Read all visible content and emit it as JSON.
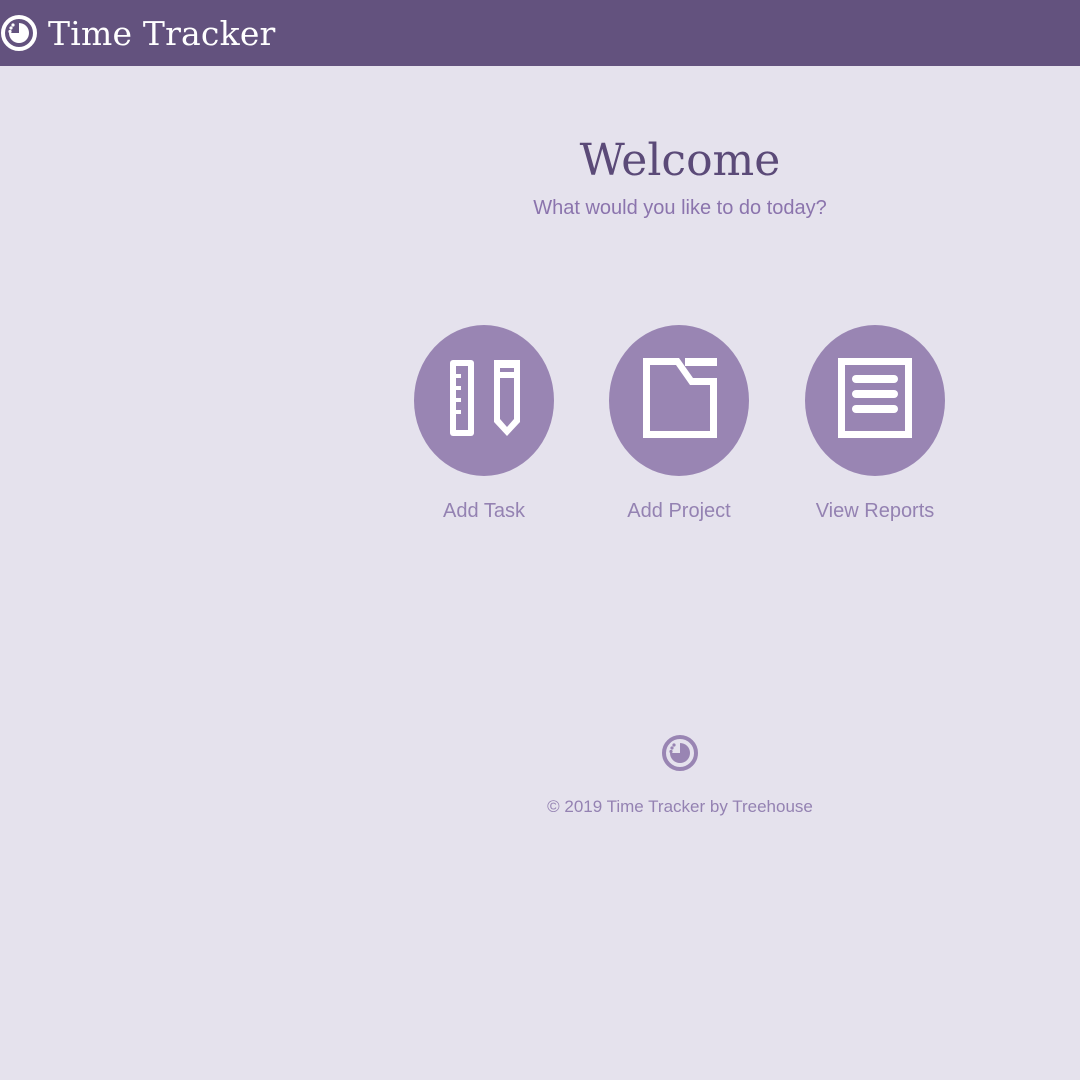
{
  "header": {
    "title": "Time Tracker",
    "logo_icon": "clock-icon"
  },
  "main": {
    "title": "Welcome",
    "subtitle": "What would you like to do today?",
    "actions": [
      {
        "label": "Add Task",
        "icon": "ruler-pencil-icon"
      },
      {
        "label": "Add Project",
        "icon": "folder-icon"
      },
      {
        "label": "View Reports",
        "icon": "document-icon"
      }
    ]
  },
  "footer": {
    "icon": "clock-icon",
    "text": "© 2019 Time Tracker by Treehouse"
  },
  "colors": {
    "header_bg": "#63527e",
    "page_bg": "#e5e2ed",
    "accent_circle": "#9985b3",
    "title_text": "#5b4a78",
    "muted_text": "#9482b2"
  }
}
